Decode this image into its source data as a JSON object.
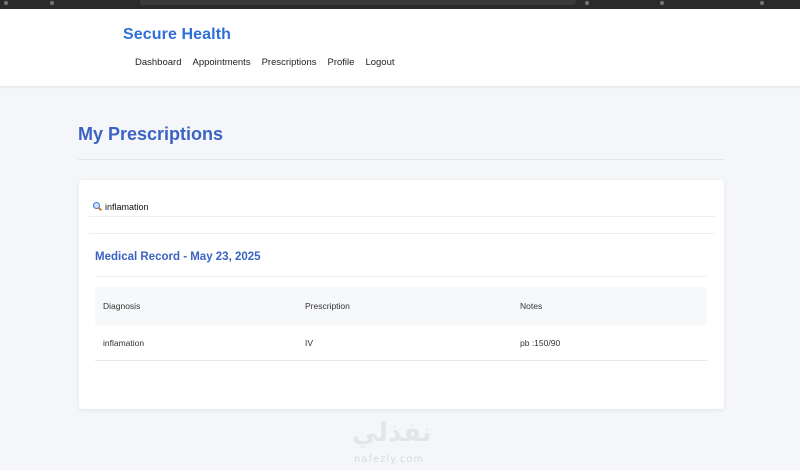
{
  "app": {
    "brand": "Secure Health"
  },
  "nav": {
    "items": [
      {
        "label": "Dashboard"
      },
      {
        "label": "Appointments"
      },
      {
        "label": "Prescriptions"
      },
      {
        "label": "Profile"
      },
      {
        "label": "Logout"
      }
    ]
  },
  "page": {
    "title": "My Prescriptions"
  },
  "search": {
    "value": "inflamation",
    "icon": "search-icon"
  },
  "record": {
    "title": "Medical Record - May 23, 2025",
    "columns": [
      "Diagnosis",
      "Prescription",
      "Notes"
    ],
    "rows": [
      {
        "diagnosis": "inflamation",
        "prescription": "IV",
        "notes": "pb :150/90"
      }
    ]
  },
  "watermark": {
    "arabic": "نفذلي",
    "latin": "nafezly.com"
  },
  "colors": {
    "brand": "#2f6fd6",
    "heading": "#3b63c4",
    "background": "#f4f6f9"
  }
}
